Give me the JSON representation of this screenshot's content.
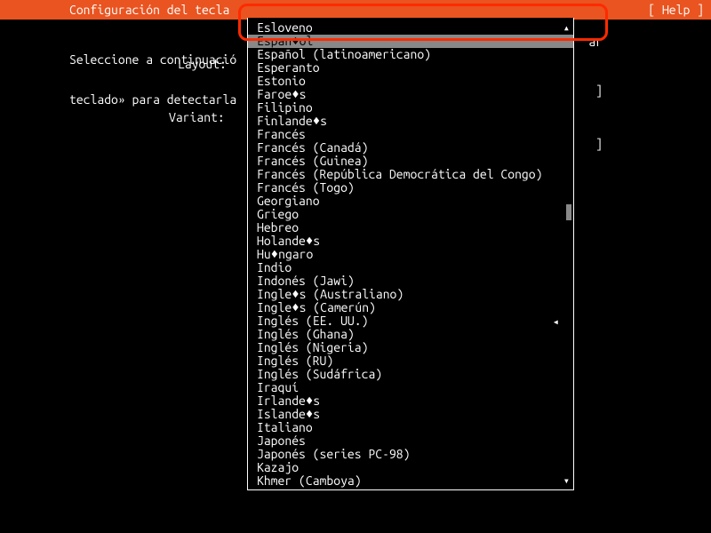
{
  "header": {
    "title": "Configuración del tecla",
    "help": "[ Help ]"
  },
  "body": {
    "line1": "Seleccione a continuació",
    "line2": "teclado» para detectarla",
    "partial_right": "ar",
    "layout_label": "Layout:",
    "variant_label": "Variant:"
  },
  "rside_marks": {
    "a": "]",
    "b": "]"
  },
  "dropdown": {
    "selected_index": 1,
    "current_index": 21,
    "options": [
      "Esloveno",
      "Espan♦ol",
      "Español (latinoamericano)",
      "Esperanto",
      "Estonio",
      "Faroe♦s",
      "Filipino",
      "Finlande♦s",
      "Francés",
      "Francés (Canadá)",
      "Francés (Guinea)",
      "Francés (República Democrática del Congo)",
      "Francés (Togo)",
      "Georgiano",
      "Griego",
      "Hebreo",
      "Holande♦s",
      "Hu♦ngaro",
      "Indio",
      "Indonés (Jawi)",
      "Ingle♦s (Australiano)",
      "Ingle♦s (Camerún)",
      "Inglés (EE. UU.)",
      "Inglés (Ghana)",
      "Inglés (Nigeria)",
      "Inglés (RU)",
      "Inglés (Sudáfrica)",
      "Iraquí",
      "Irlande♦s",
      "Islande♦s",
      "Italiano",
      "Japonés",
      "Japonés (series PC-98)",
      "Kazajo",
      "Khmer (Camboya)"
    ]
  }
}
